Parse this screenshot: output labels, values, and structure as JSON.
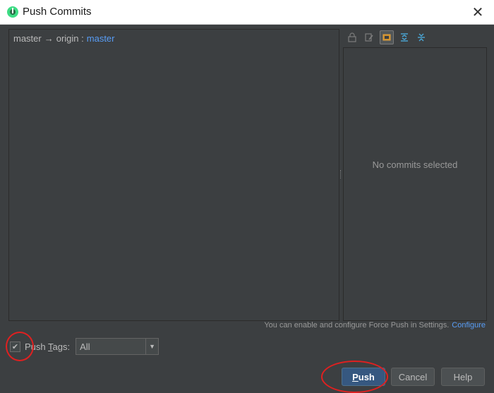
{
  "window": {
    "title": "Push Commits",
    "close_symbol": "✕"
  },
  "branch": {
    "local": "master",
    "arrow": "→",
    "remote_name": "origin :",
    "remote_branch": "master"
  },
  "toolbar": {
    "icons": [
      "lock-icon",
      "edit-icon",
      "show-details-icon",
      "expand-all-icon",
      "collapse-all-icon"
    ],
    "active_index": 2
  },
  "details": {
    "empty_text": "No commits selected"
  },
  "force_push": {
    "text": "You can enable and configure Force Push in Settings.",
    "link": "Configure"
  },
  "tags": {
    "checked": true,
    "label_prefix": "Push ",
    "label_mnemonic": "T",
    "label_suffix": "ags:",
    "selected": "All"
  },
  "buttons": {
    "push_mnemonic": "P",
    "push_rest": "ush",
    "cancel": "Cancel",
    "help": "Help"
  },
  "colors": {
    "accent": "#589df6",
    "highlight_ellipse": "#e02020",
    "primary_button": "#365880"
  }
}
